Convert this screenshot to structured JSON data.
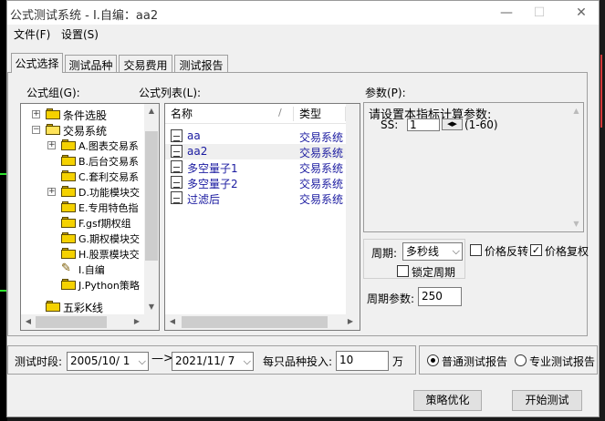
{
  "window": {
    "title": "公式测试系统 - I.自编：aa2"
  },
  "menu": {
    "file": "文件(F)",
    "settings": "设置(S)"
  },
  "tabs": [
    "公式选择",
    "测试品种",
    "交易费用",
    "测试报告"
  ],
  "formula_group": {
    "label": "公式组(G):",
    "items": [
      {
        "label": "条件选股",
        "level": 1,
        "expander": "+"
      },
      {
        "label": "交易系统",
        "level": 1,
        "expander": "-"
      },
      {
        "label": "A.图表交易系",
        "level": 2,
        "expander": "+"
      },
      {
        "label": "B.后台交易系",
        "level": 2,
        "expander": ""
      },
      {
        "label": "C.套利交易系",
        "level": 2,
        "expander": ""
      },
      {
        "label": "D.功能模块交",
        "level": 2,
        "expander": "+"
      },
      {
        "label": "E.专用特色指",
        "level": 2,
        "expander": ""
      },
      {
        "label": "F.gsf期权组",
        "level": 2,
        "expander": ""
      },
      {
        "label": "G.期权模块交",
        "level": 2,
        "expander": ""
      },
      {
        "label": "H.股票模块交",
        "level": 2,
        "expander": ""
      },
      {
        "label": "I.自编",
        "level": 2,
        "expander": "",
        "icon": "pen"
      },
      {
        "label": "J.Python策略",
        "level": 2,
        "expander": ""
      },
      {
        "label": "五彩K线",
        "level": 1,
        "expander": ""
      }
    ]
  },
  "formula_list": {
    "label": "公式列表(L):",
    "columns": [
      "名称",
      "类型"
    ],
    "rows": [
      {
        "name": "aa",
        "type": "交易系统"
      },
      {
        "name": "aa2",
        "type": "交易系统"
      },
      {
        "name": "多空量子1",
        "type": "交易系统"
      },
      {
        "name": "多空量子2",
        "type": "交易系统"
      },
      {
        "name": "过滤后",
        "type": "交易系统"
      }
    ],
    "selected_index": 1
  },
  "params": {
    "label": "参数(P):",
    "prompt": "请设置本指标计算参数:",
    "name": "SS:",
    "value": "1",
    "range": "(1-60)"
  },
  "period": {
    "label": "周期:",
    "value": "多秒线",
    "lock_label": "锁定周期",
    "lock_checked": false,
    "param_label": "周期参数:",
    "param_value": "250"
  },
  "price_options": {
    "reverse_label": "价格反转",
    "reverse_checked": false,
    "restore_label": "价格复权",
    "restore_checked": true
  },
  "test_range": {
    "label": "测试时段:",
    "start": "2005/10/ 1",
    "arrow": "—>",
    "end": "2021/11/ 7",
    "invest_label": "每只品种投入:",
    "invest_value": "10",
    "unit": "万"
  },
  "report_type": {
    "normal_label": "普通测试报告",
    "pro_label": "专业测试报告",
    "selected": "normal"
  },
  "buttons": {
    "optimize": "策略优化",
    "start": "开始测试"
  }
}
